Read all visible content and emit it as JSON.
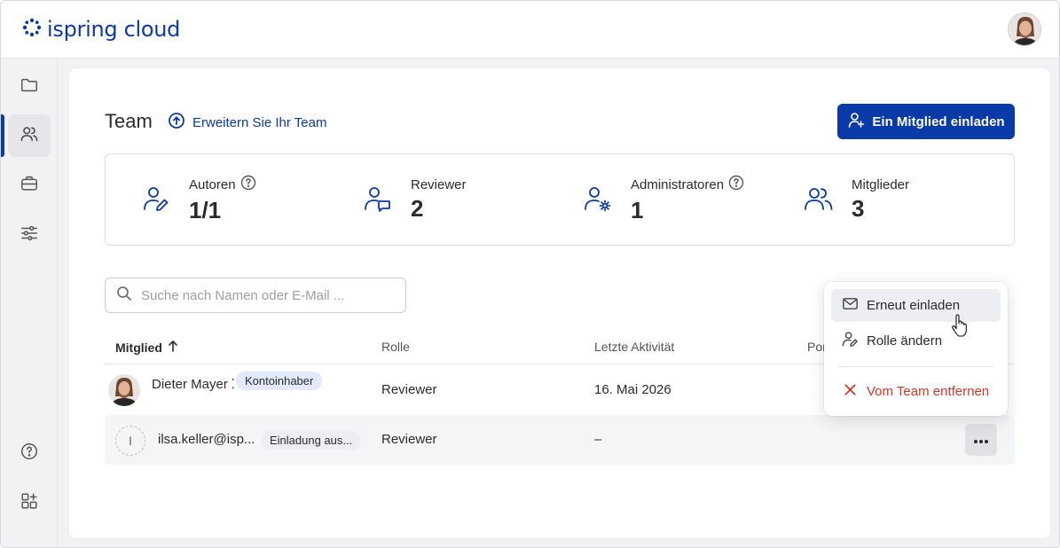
{
  "brand": {
    "name": "ispring cloud",
    "color": "#0a3aa8"
  },
  "sidebar": {
    "items": [
      {
        "name": "folder-icon"
      },
      {
        "name": "users-icon",
        "active": true
      },
      {
        "name": "briefcase-icon"
      },
      {
        "name": "sliders-icon"
      }
    ],
    "bottom": [
      {
        "name": "help-icon"
      },
      {
        "name": "apps-icon"
      }
    ]
  },
  "page": {
    "title": "Team",
    "expand_link": "Erweitern Sie Ihr Team",
    "invite_button": "Ein Mitglied einladen"
  },
  "stats": [
    {
      "label": "Autoren",
      "value": "1/1",
      "help": true,
      "icon": "user-pen-icon"
    },
    {
      "label": "Reviewer",
      "value": "2",
      "help": false,
      "icon": "user-comment-icon"
    },
    {
      "label": "Administratoren",
      "value": "1",
      "help": true,
      "icon": "user-gear-icon"
    },
    {
      "label": "Mitglieder",
      "value": "3",
      "help": false,
      "icon": "users-icon"
    }
  ],
  "search": {
    "placeholder": "Suche nach Namen oder E-Mail ...",
    "value": ""
  },
  "table": {
    "columns": [
      "Mitglied",
      "Rolle",
      "Letzte Aktivität",
      "Por"
    ],
    "sort_column": "Mitglied",
    "rows": [
      {
        "name": "Dieter Mayer",
        "name_trunc": "Dieter Mayer ⸬",
        "badge": "Kontoinhaber",
        "role": "Reviewer",
        "last_activity": "16. Mai 2026",
        "avatar": "photo"
      },
      {
        "name": "ilsa.keller@isp...",
        "badge": "Einladung aus...",
        "role": "Reviewer",
        "last_activity": "–",
        "avatar_initial": "I"
      }
    ]
  },
  "row_menu": {
    "items": [
      {
        "label": "Erneut einladen",
        "icon": "mail-icon"
      },
      {
        "label": "Rolle ändern",
        "icon": "user-edit-icon"
      },
      {
        "label": "Vom Team entfernen",
        "icon": "close-icon",
        "danger": true
      }
    ],
    "danger_color": "#d1372b"
  }
}
